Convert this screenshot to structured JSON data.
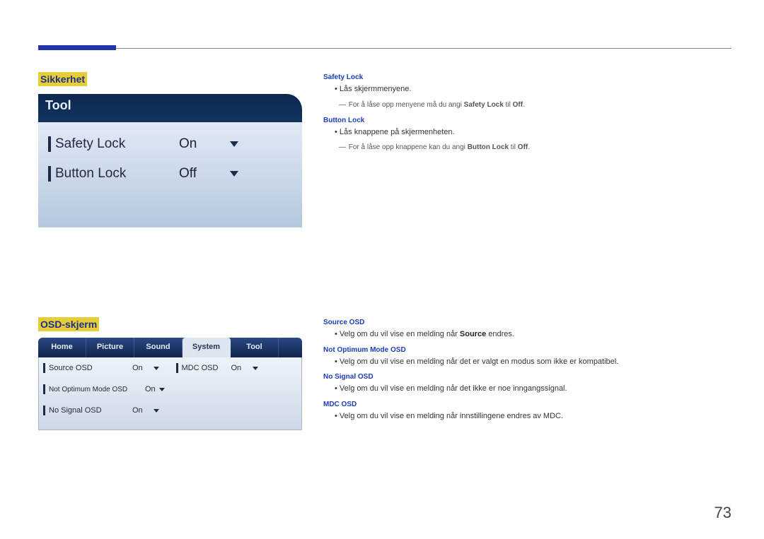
{
  "pageNumber": "73",
  "sikkerhet": {
    "heading": "Sikkerhet",
    "safetyLock": {
      "title": "Safety Lock",
      "bullet": "Lås skjermmenyene.",
      "note_before": "For å låse opp menyene må du angi ",
      "note_bold": "Safety Lock",
      "note_mid": " til ",
      "note_bold2": "Off",
      "note_after": "."
    },
    "buttonLock": {
      "title": "Button Lock",
      "bullet": "Lås knappene på skjermenheten.",
      "note_before": "For å låse opp knappene kan du angi ",
      "note_bold": "Button Lock",
      "note_mid": " til ",
      "note_bold2": "Off",
      "note_after": "."
    },
    "panel": {
      "header": "Tool",
      "row1_label": "Safety Lock",
      "row1_value": "On",
      "row2_label": "Button Lock",
      "row2_value": "Off"
    }
  },
  "osd": {
    "heading": "OSD-skjerm",
    "items": {
      "source": {
        "title": "Source OSD",
        "bullet_pre": "Velg om du vil vise en melding når ",
        "bullet_bold": "Source",
        "bullet_post": " endres."
      },
      "notopt": {
        "title": "Not Optimum Mode OSD",
        "bullet": "Velg om du vil vise en melding når det er valgt en modus som ikke er kompatibel."
      },
      "nosig": {
        "title": "No Signal OSD",
        "bullet": "Velg om du vil vise en melding når det ikke er noe inngangssignal."
      },
      "mdc": {
        "title": "MDC OSD",
        "bullet": "Velg om du vil vise en melding når innstillingene endres av MDC."
      }
    },
    "panel": {
      "tabs": {
        "t0": "Home",
        "t1": "Picture",
        "t2": "Sound",
        "t3": "System",
        "t4": "Tool"
      },
      "rows": {
        "r0_label": "Source OSD",
        "r0_val": "On",
        "r1_label": "MDC OSD",
        "r1_val": "On",
        "r2_label": "Not Optimum Mode OSD",
        "r2_val": "On",
        "r3_label": "No Signal OSD",
        "r3_val": "On"
      }
    }
  }
}
